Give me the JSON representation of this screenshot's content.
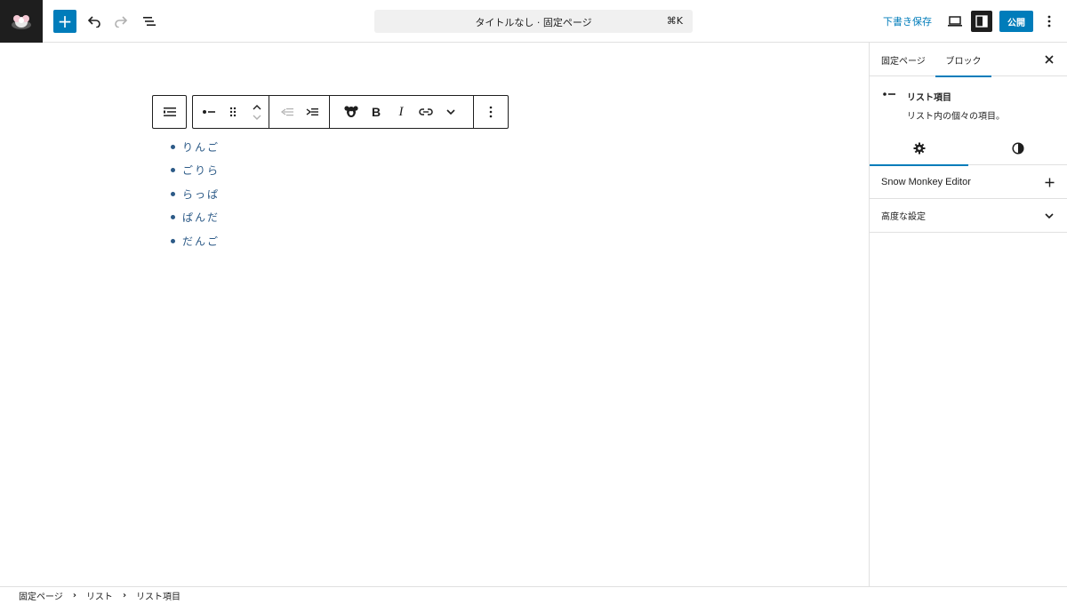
{
  "header": {
    "logo_icon": "snow-monkey-logo-icon",
    "add_label": "+",
    "doc_title": "タイトルなし · 固定ページ",
    "shortcut": "⌘K",
    "draft_label": "下書き保存",
    "publish_label": "公開"
  },
  "toolbar": {
    "bold_label": "B",
    "italic_label": "I"
  },
  "list": {
    "items": [
      "りんご",
      "ごりら",
      "らっぱ",
      "ぱんだ",
      "だんご"
    ]
  },
  "sidebar": {
    "tabs": {
      "page": "固定ページ",
      "block": "ブロック"
    },
    "block_card": {
      "title": "リスト項目",
      "description": "リスト内の個々の項目。"
    },
    "panels": {
      "snow_monkey": "Snow Monkey Editor",
      "advanced": "高度な設定"
    }
  },
  "breadcrumb": [
    "固定ページ",
    "リスト",
    "リスト項目"
  ],
  "colors": {
    "accent": "#007cba",
    "dark": "#1e1e1e",
    "list_text": "#2c5a87"
  }
}
